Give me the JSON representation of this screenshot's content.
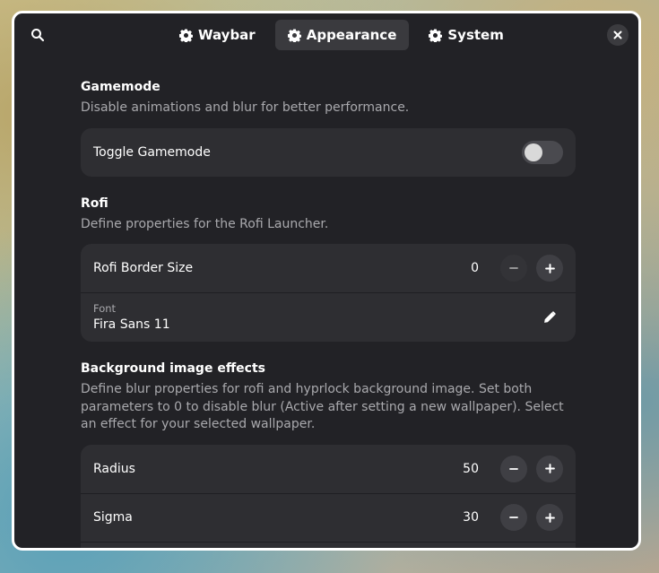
{
  "header": {
    "tabs": [
      {
        "label": "Waybar",
        "icon": "gear-icon",
        "active": false
      },
      {
        "label": "Appearance",
        "icon": "gear-icon",
        "active": true
      },
      {
        "label": "System",
        "icon": "gear-icon",
        "active": false
      }
    ],
    "search_icon": "search-icon",
    "close_icon": "close-icon"
  },
  "gamemode": {
    "title": "Gamemode",
    "description": "Disable animations and blur for better performance.",
    "toggle_label": "Toggle Gamemode",
    "toggle_on": false
  },
  "rofi": {
    "title": "Rofi",
    "description": "Define properties for the Rofi Launcher.",
    "border_label": "Rofi Border Size",
    "border_value": "0",
    "font_caption": "Font",
    "font_value": "Fira Sans 11"
  },
  "background": {
    "title": "Background image effects",
    "description": "Define blur properties for rofi and hyprlock background image. Set both parameters to 0 to disable blur (Active after setting a new wallpaper). Select an effect for your selected wallpaper.",
    "radius_label": "Radius",
    "radius_value": "50",
    "sigma_label": "Sigma",
    "sigma_value": "30"
  },
  "colors": {
    "window_bg": "#222226",
    "card_bg": "#2e2e32",
    "active_tab": "#3a3a3e"
  }
}
